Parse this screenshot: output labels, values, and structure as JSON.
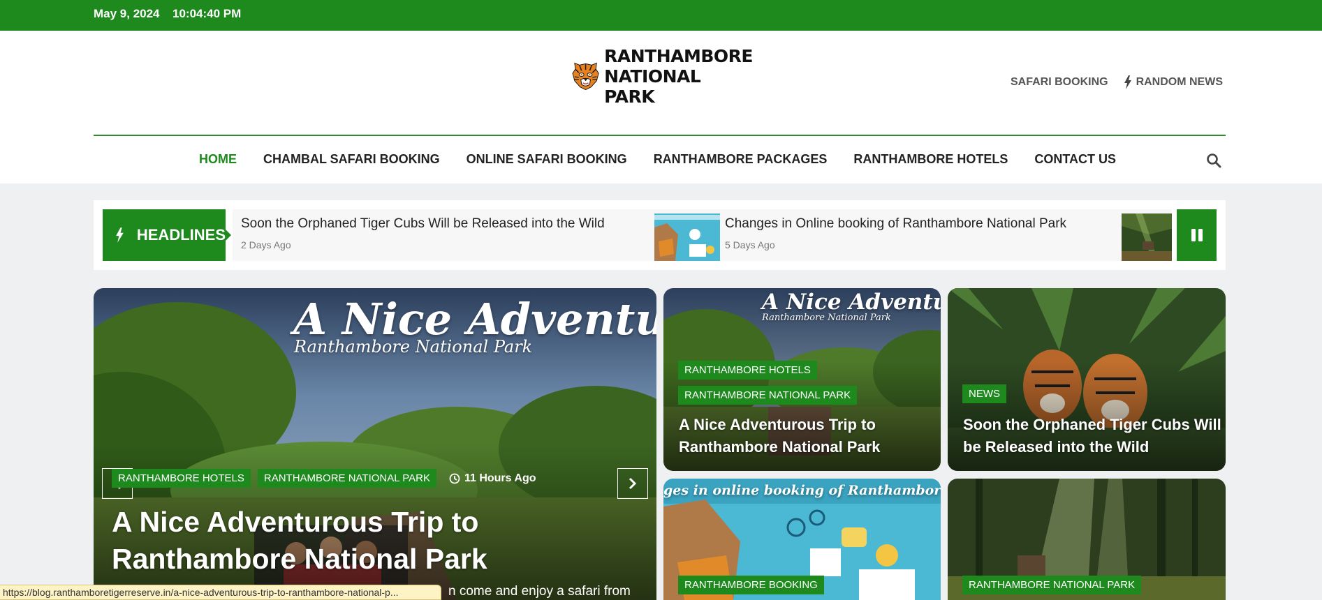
{
  "topbar": {
    "date": "May 9, 2024",
    "time": "10:04:40 PM",
    "color": "#1e8a1e"
  },
  "header": {
    "logo": {
      "line1": "RANTHAMBORE",
      "line2": "NATIONAL PARK",
      "icon": "tiger-icon"
    },
    "links": [
      {
        "label": "SAFARI BOOKING",
        "icon": null
      },
      {
        "label": "RANDOM NEWS",
        "icon": "lightning-icon"
      }
    ]
  },
  "nav": {
    "items": [
      "HOME",
      "CHAMBAL SAFARI BOOKING",
      "ONLINE SAFARI BOOKING",
      "RANTHAMBORE PACKAGES",
      "RANTHAMBORE HOTELS",
      "CONTACT US"
    ],
    "active": "HOME",
    "search_icon": "search-icon"
  },
  "ticker": {
    "label": "HEADLINES",
    "items": [
      {
        "title": "Soon the Orphaned Tiger Cubs Will be Released into the Wild",
        "time": "2 Days Ago"
      },
      {
        "title": "Changes in Online booking of Ranthambore National Park",
        "time": "5 Days Ago"
      }
    ],
    "pause_icon": "pause-icon"
  },
  "featured": {
    "image_title": "A Nice Adventurous T",
    "image_subtitle": "Ranthambore National Park",
    "tags": [
      "RANTHAMBORE HOTELS",
      "RANTHAMBORE NATIONAL PARK"
    ],
    "time": "11 Hours Ago",
    "title": "A Nice Adventurous Trip to Ranthambore National Park",
    "excerpt": "n come and enjoy a safari from"
  },
  "cards": [
    {
      "image_title": "A Nice Adventurous T",
      "image_subtitle": "Ranthambore National Park",
      "tags": [
        "RANTHAMBORE HOTELS",
        "RANTHAMBORE NATIONAL PARK"
      ],
      "title": "A Nice Adventurous Trip to Ranthambore National Park"
    },
    {
      "tags": [
        "NEWS"
      ],
      "title": "Soon the Orphaned Tiger Cubs Will be Released into the Wild"
    },
    {
      "image_title": "ges in online booking of Ranthambore National",
      "tags": [
        "RANTHAMBORE BOOKING"
      ]
    },
    {
      "tags": [
        "RANTHAMBORE NATIONAL PARK"
      ]
    }
  ],
  "status_bar": {
    "url": "https://blog.ranthamboretigerreserve.in/a-nice-adventurous-trip-to-ranthambore-national-p..."
  }
}
